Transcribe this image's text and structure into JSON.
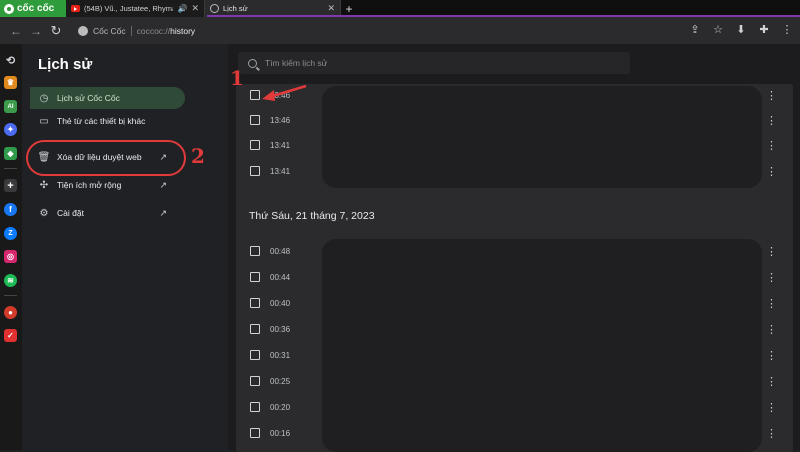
{
  "browser": {
    "logo_text": "cốc cốc",
    "tabs": [
      {
        "title": "(54B) Vũ., Justatee, Rhymastic",
        "active": false
      },
      {
        "title": "Lịch sử",
        "active": true
      }
    ],
    "new_tab_label": "+",
    "omnibox": {
      "site_label": "Cốc Cốc",
      "url_prefix": "coccoc://",
      "url_path": "history"
    }
  },
  "sidebar": {
    "title": "Lịch sử",
    "items": [
      {
        "label": "Lịch sử Cốc Cốc",
        "icon": "clock-icon",
        "active": true
      },
      {
        "label": "Thẻ từ các thiết bị khác",
        "icon": "devices-icon"
      },
      {
        "label": "Xóa dữ liệu duyệt web",
        "icon": "trash-icon",
        "external": true
      },
      {
        "label": "Tiện ích mở rộng",
        "icon": "puzzle-icon",
        "external": true
      },
      {
        "label": "Cài đặt",
        "icon": "gear-icon",
        "external": true
      }
    ]
  },
  "search": {
    "placeholder": "Tìm kiếm lịch sử"
  },
  "groups": [
    {
      "date": "",
      "rows": [
        {
          "time": "13:46"
        },
        {
          "time": "13:46"
        },
        {
          "time": "13:41"
        },
        {
          "time": "13:41"
        }
      ]
    },
    {
      "date": "Thứ Sáu, 21 tháng 7, 2023",
      "rows": [
        {
          "time": "00:48"
        },
        {
          "time": "00:44"
        },
        {
          "time": "00:40"
        },
        {
          "time": "00:36"
        },
        {
          "time": "00:31"
        },
        {
          "time": "00:25"
        },
        {
          "time": "00:20"
        },
        {
          "time": "00:16"
        }
      ]
    }
  ],
  "annotations": {
    "step1": "1",
    "step2": "2",
    "color": "#e03a3a"
  }
}
